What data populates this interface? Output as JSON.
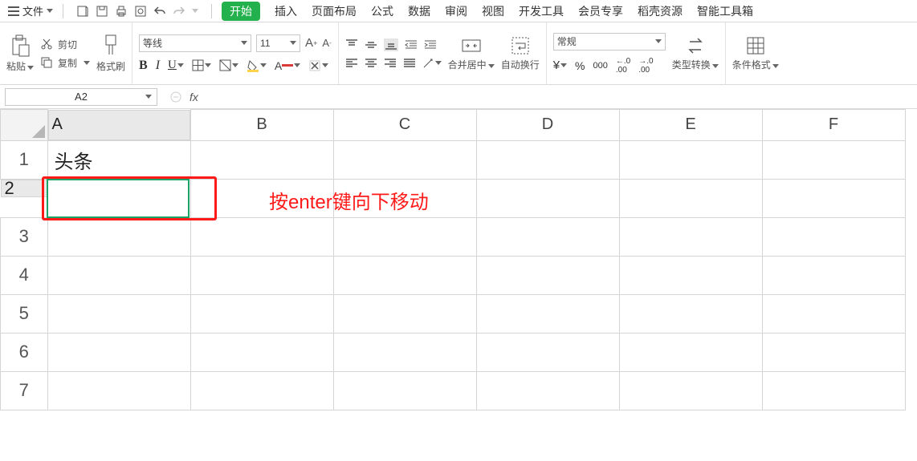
{
  "menu": {
    "file": "文件",
    "tabs": [
      "开始",
      "插入",
      "页面布局",
      "公式",
      "数据",
      "审阅",
      "视图",
      "开发工具",
      "会员专享",
      "稻壳资源",
      "智能工具箱"
    ],
    "active_tab_index": 0
  },
  "clipboard": {
    "paste": "粘贴",
    "cut": "剪切",
    "copy": "复制",
    "format_painter": "格式刷"
  },
  "font": {
    "name": "等线",
    "size": "11"
  },
  "alignment": {
    "merge": "合并居中",
    "wrap": "自动换行"
  },
  "number": {
    "format": "常规",
    "type_convert": "类型转换"
  },
  "cond_format": "条件格式",
  "namebox": "A2",
  "columns": [
    "A",
    "B",
    "C",
    "D",
    "E",
    "F"
  ],
  "rows": [
    "1",
    "2",
    "3",
    "4",
    "5",
    "6",
    "7"
  ],
  "selected_col_index": 0,
  "selected_row_index": 1,
  "cells": {
    "A1": "头条"
  },
  "annotation_text": "按enter键向下移动"
}
